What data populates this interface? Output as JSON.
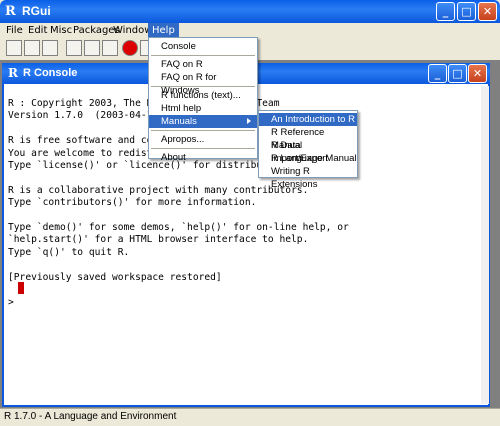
{
  "window": {
    "title": "RGui"
  },
  "menubar": [
    "File",
    "Edit",
    "Misc",
    "Packages",
    "Windows",
    "Help"
  ],
  "help_menu": {
    "items": [
      {
        "label": "Console"
      },
      {
        "sep": true
      },
      {
        "label": "FAQ on R"
      },
      {
        "label": "FAQ on R for Windows"
      },
      {
        "sep": true
      },
      {
        "label": "R functions (text)..."
      },
      {
        "label": "Html help"
      },
      {
        "label": "Manuals",
        "submenu": true
      },
      {
        "sep": true
      },
      {
        "label": "Apropos..."
      },
      {
        "sep": true
      },
      {
        "label": "About"
      }
    ]
  },
  "manuals_menu": {
    "items": [
      "An Introduction to R",
      "R Reference Manual",
      "R Data Import/Export",
      "R Language Manual",
      "Writing R Extensions"
    ]
  },
  "console": {
    "title": "R Console",
    "lines": [
      "R : Copyright 2003, The R Development Core Team",
      "Version 1.7.0  (2003-04-16)",
      "",
      "R is free software and comes with ABSOLUTELY NO WARRANTY.",
      "You are welcome to redistribute it under certain conditions.",
      "Type `license()' or `licence()' for distribution details.",
      "",
      "R is a collaborative project with many contributors.",
      "Type `contributors()' for more information.",
      "",
      "Type `demo()' for some demos, `help()' for on-line help, or",
      "`help.start()' for a HTML browser interface to help.",
      "Type `q()' to quit R.",
      "",
      "[Previously saved workspace restored]",
      "",
      ">"
    ]
  },
  "status": {
    "text": "R 1.7.0 - A Language and Environment"
  }
}
